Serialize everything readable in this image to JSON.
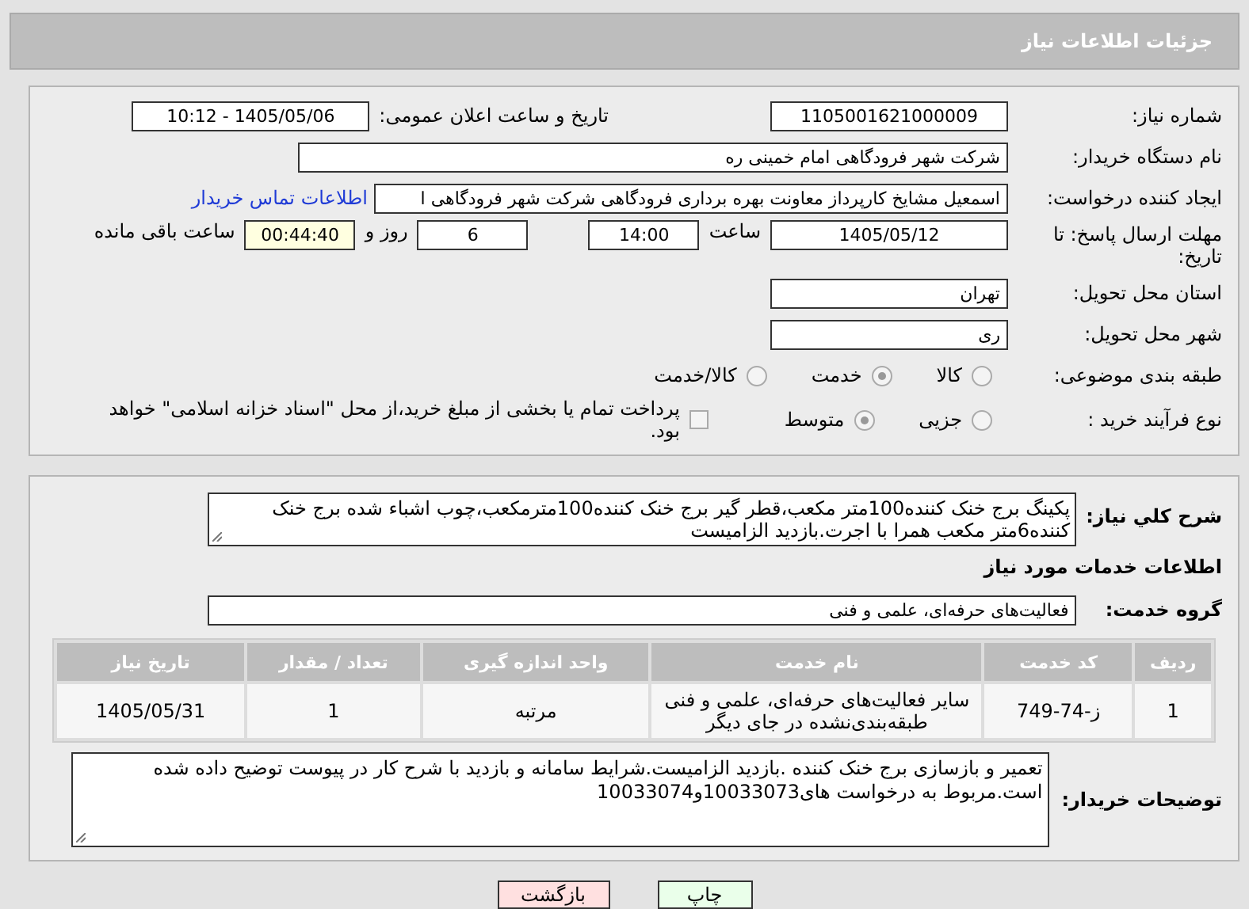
{
  "header": {
    "title": "جزئیات اطلاعات نیاز"
  },
  "need_number": {
    "label": "شماره نیاز:",
    "value": "1105001621000009"
  },
  "announce": {
    "label": "تاریخ و ساعت اعلان عمومی:",
    "value": "1405/05/06 - 10:12"
  },
  "buyer": {
    "label": "نام دستگاه خریدار:",
    "value": "شرکت شهر فرودگاهی امام خمینی  ره"
  },
  "requester": {
    "label": "ایجاد کننده درخواست:",
    "value": "اسمعیل مشایخ کارپرداز معاونت بهره برداری فرودگاهی شرکت شهر فرودگاهی ا",
    "link": "اطلاعات تماس خریدار"
  },
  "deadline": {
    "label": "مهلت ارسال پاسخ: تا تاریخ:",
    "date": "1405/05/12",
    "time_label": "ساعت",
    "time": "14:00",
    "days": "6",
    "days_label": "روز و",
    "remaining": "00:44:40",
    "remaining_label": "ساعت باقی مانده"
  },
  "province": {
    "label": "استان محل تحویل:",
    "value": "تهران"
  },
  "city": {
    "label": "شهر محل تحویل:",
    "value": "ری"
  },
  "category": {
    "label": "طبقه بندی موضوعی:",
    "options": [
      {
        "label": "کالا",
        "selected": false
      },
      {
        "label": "خدمت",
        "selected": true
      },
      {
        "label": "کالا/خدمت",
        "selected": false
      }
    ]
  },
  "process": {
    "label": "نوع فرآیند خرید :",
    "options": [
      {
        "label": "جزیی",
        "selected": false
      },
      {
        "label": "متوسط",
        "selected": true
      }
    ],
    "payment": {
      "label": "پرداخت تمام یا بخشی از مبلغ خرید،از محل \"اسناد خزانه اسلامی\" خواهد بود.",
      "checked": false
    }
  },
  "description": {
    "label": "شرح کلي نياز:",
    "value": "پکینگ برج خنک کننده100متر مکعب،قطر گیر برج خنک کننده100مترمکعب،چوب اشباء شده برج خنک کننده6متر مکعب همرا با اجرت.بازدید الزامیست"
  },
  "services_title": "اطلاعات خدمات مورد نياز",
  "service_group": {
    "label": "گروه خدمت:",
    "value": "فعالیت‌های حرفه‌ای، علمی و فنی"
  },
  "table": {
    "columns": [
      "ردیف",
      "کد خدمت",
      "نام خدمت",
      "واحد اندازه گیری",
      "تعداد / مقدار",
      "تاریخ نیاز"
    ],
    "rows": [
      [
        "1",
        "ز-74-749",
        "سایر فعالیت‌های حرفه‌ای، علمی و فنی طبقه‌بندی‌نشده در جای دیگر",
        "مرتبه",
        "1",
        "1405/05/31"
      ]
    ]
  },
  "notes": {
    "label": "توضیحات خریدار:",
    "value": "تعمیر و بازسازی برج خنک کننده .بازدید الزامیست.شرایط سامانه و بازدید با شرح کار در پیوست توضیح داده شده است.مربوط به درخواست های10033073و10033074"
  },
  "buttons": [
    {
      "label": "چاپ",
      "kind": "print"
    },
    {
      "label": "بازگشت",
      "kind": "back"
    }
  ]
}
